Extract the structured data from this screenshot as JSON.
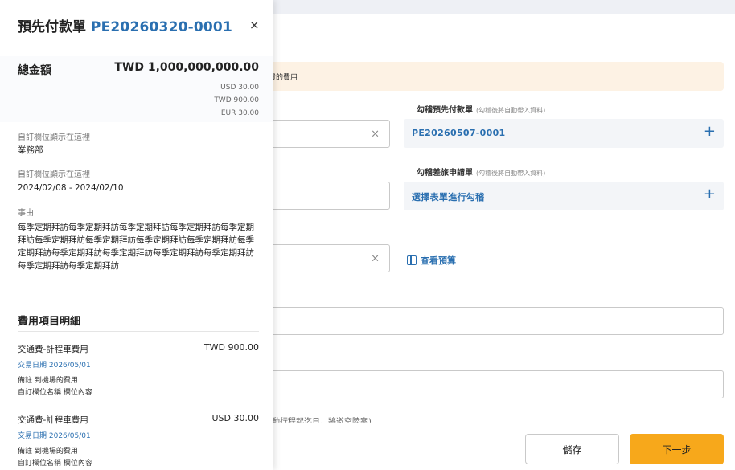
{
  "panel": {
    "title": "預先付款單",
    "number": "PE20260320-0001",
    "close_symbol": "×",
    "total_label": "總金額",
    "total_value": "TWD 1,000,000,000.00",
    "subtotals": [
      "USD 30.00",
      "TWD 900.00",
      "EUR 30.00"
    ],
    "fields": [
      {
        "label": "自訂欄位顯示在這裡",
        "value": "業務部"
      },
      {
        "label": "自訂欄位顯示在這裡",
        "value": "2024/02/08 - 2024/02/10"
      }
    ],
    "reason_label": "事由",
    "reason_value": "每季定期拜訪每季定期拜訪每季定期拜訪每季定期拜訪每季定期拜訪每季定期拜訪每季定期拜訪每季定期拜訪每季定期拜訪每季定期拜訪每季定期拜訪每季定期拜訪每季定期拜訪每季定期拜訪每季定期拜訪每季定期拜訪",
    "section_title": "費用項目明細",
    "items": [
      {
        "name": "交通費-計程車費用",
        "amount": "TWD 900.00",
        "date": "交易日期 2026/05/01",
        "note1": "備註 到機場的費用",
        "note2": "自訂欄位名稱  欄位內容"
      },
      {
        "name": "交通費-計程車費用",
        "amount": "USD 30.00",
        "date": "交易日期 2026/05/01",
        "note1": "備註 到機場的費用",
        "note2": "自訂欄位名稱  欄位內容"
      }
    ]
  },
  "form": {
    "notice_text": "費的費用",
    "clear_symbol": "×",
    "prepay_label": "勾稽預先付款單",
    "prepay_hint": "(勾稽後將自動帶入資料)",
    "prepay_value": "PE20260507-0001",
    "travel_label": "勾稽差旅申請單",
    "travel_hint": "(勾稽後將自動帶入資料)",
    "travel_value": "選擇表單進行勾稽",
    "plus_symbol": "+",
    "budget_link": "查看預算",
    "partial_text": "動行程起迄日，將邀空陸案)",
    "save_label": "儲存",
    "next_label": "下一步"
  },
  "colors": {
    "accent": "#2a6fb0",
    "primary_button": "#f7a81b",
    "notice_bg": "#fdf2e4"
  }
}
